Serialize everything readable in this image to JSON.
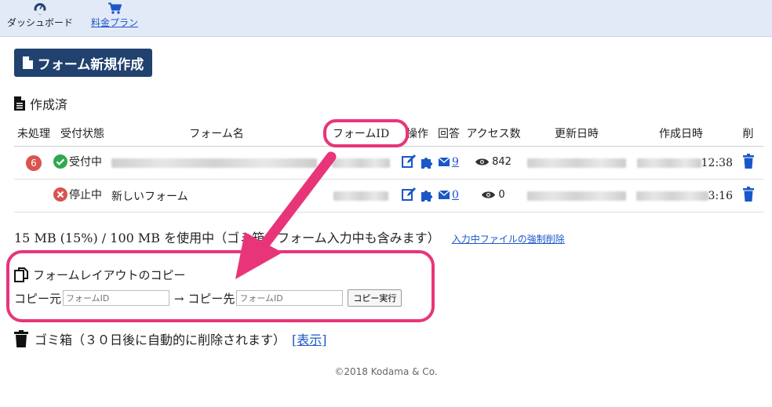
{
  "nav": {
    "dashboard_label": "ダッシュボード",
    "plan_label": "料金プラン"
  },
  "create_button_label": "フォーム新規作成",
  "section_title": "作成済",
  "table": {
    "headers": [
      "未処理",
      "受付状態",
      "フォーム名",
      "フォームID",
      "操作",
      "回答",
      "アクセス数",
      "更新日時",
      "作成日時",
      "削"
    ],
    "rows": [
      {
        "unprocessed": "6",
        "status": "受付中",
        "form_name": "",
        "answers": "9",
        "views": "842",
        "created_time_suffix": "12:38"
      },
      {
        "unprocessed": "",
        "status": "停止中",
        "form_name": "新しいフォーム",
        "answers": "0",
        "views": "0",
        "created_time_suffix": "3:16"
      }
    ]
  },
  "usage": {
    "text": "15 MB (15%) / 100 MB を使用中（ゴミ箱、フォーム入力中も含みます）",
    "purge_link": "入力中ファイルの強制削除"
  },
  "copy": {
    "title": "フォームレイアウトのコピー",
    "source_label": "コピー元",
    "source_placeholder": "フォームID",
    "arrow_label": "→ コピー先",
    "target_placeholder": "フォームID",
    "button_label": "コピー実行"
  },
  "trash": {
    "text": "ゴミ箱（３０日後に自動的に削除されます）",
    "link": "[表示]"
  },
  "footer": "©2018 Kodama & Co.",
  "colors": {
    "nav_bg": "#e3eaf7",
    "primary_button": "#21426f",
    "link": "#1a57c9",
    "badge": "#d9534f",
    "success": "#2fa84f",
    "stop": "#d9534f",
    "annotation": "#e8357a"
  }
}
